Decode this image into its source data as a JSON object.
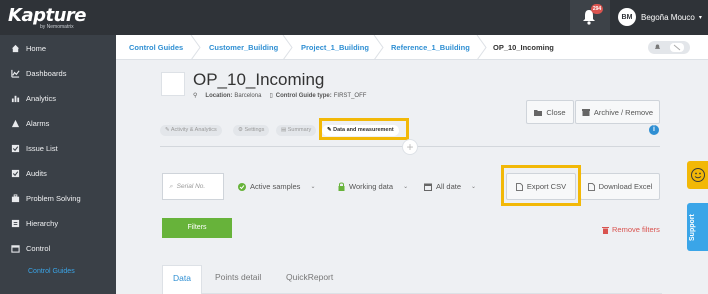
{
  "app": {
    "logo": "Kapture",
    "logo_sub": "by Nemomatrix",
    "notification_count": "294",
    "user_initials": "BM",
    "user_name": "Begoña Mouco"
  },
  "sidebar": {
    "items": [
      {
        "label": "Home",
        "icon": "home-icon"
      },
      {
        "label": "Dashboards",
        "icon": "chart-icon"
      },
      {
        "label": "Analytics",
        "icon": "bar-chart-icon"
      },
      {
        "label": "Alarms",
        "icon": "alarm-icon"
      },
      {
        "label": "Issue List",
        "icon": "checkbox-icon"
      },
      {
        "label": "Audits",
        "icon": "audit-icon"
      },
      {
        "label": "Problem Solving",
        "icon": "briefcase-icon"
      },
      {
        "label": "Hierarchy",
        "icon": "hierarchy-icon"
      },
      {
        "label": "Control",
        "icon": "control-icon"
      }
    ],
    "sub_item": "Control Guides"
  },
  "breadcrumb": [
    "Control Guides",
    "Customer_Building",
    "Project_1_Building",
    "Reference_1_Building",
    "OP_10_Incoming"
  ],
  "header": {
    "title": "OP_10_Incoming",
    "location_label": "Location:",
    "location_value": "Barcelona",
    "guide_type_label": "Control Guide type:",
    "guide_type_value": "FIRST_OFF",
    "close_label": "Close",
    "archive_label": "Archive / Remove"
  },
  "top_tabs": [
    "Activity & Analytics",
    "Settings",
    "Summary",
    "Data and measurement"
  ],
  "filters": {
    "serial_placeholder": "Serial No.",
    "active_samples": "Active samples",
    "working_data": "Working data",
    "all_date": "All date",
    "export_csv": "Export CSV",
    "download_excel": "Download Excel",
    "filters_button": "Filters",
    "remove_filters": "Remove filters"
  },
  "bottom_tabs": [
    "Data",
    "Points detail",
    "QuickReport"
  ],
  "support_label": "Support",
  "colors": {
    "accent": "#2f8fd3",
    "highlight": "#f2b807",
    "green": "#67b33a",
    "red": "#d9534f"
  }
}
